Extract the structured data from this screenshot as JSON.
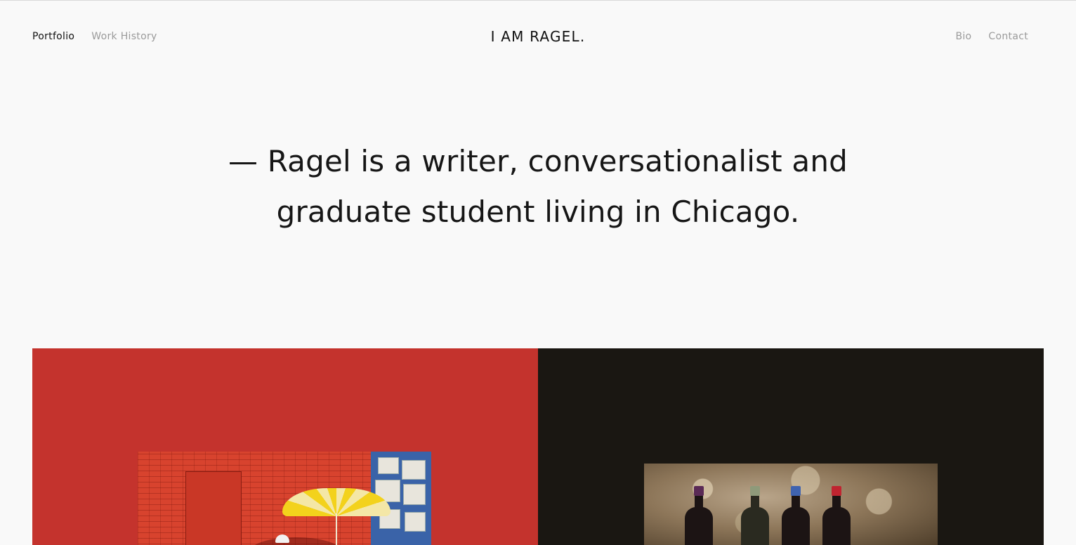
{
  "nav": {
    "left": [
      {
        "label": "Portfolio",
        "active": true
      },
      {
        "label": "Work History",
        "active": false
      }
    ],
    "right": [
      {
        "label": "Bio"
      },
      {
        "label": "Contact"
      }
    ]
  },
  "brand": {
    "label": "I AM RAGEL."
  },
  "intro": {
    "line1": "— Ragel is a writer, conversationalist and",
    "line2": "graduate student living in Chicago."
  },
  "colors": {
    "background": "#f9f9f9",
    "tile_red": "#c4332d",
    "tile_dark": "#1a1712",
    "nav_inactive": "#9a9a9a",
    "text": "#111111"
  },
  "tiles": [
    {
      "name": "portfolio-tile-street",
      "image_icon": "street-umbrella-photo"
    },
    {
      "name": "portfolio-tile-wine",
      "image_icon": "wine-bottles-photo"
    }
  ]
}
